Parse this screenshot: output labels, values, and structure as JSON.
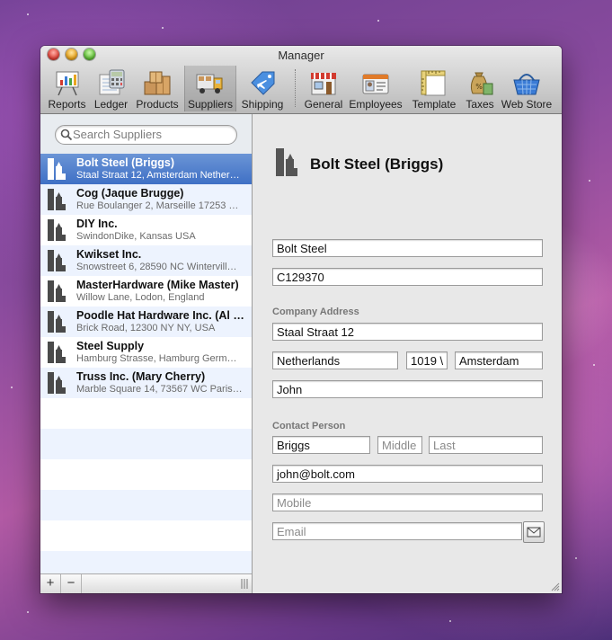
{
  "window": {
    "title": "Manager"
  },
  "toolbar": {
    "items": [
      {
        "label": "Reports",
        "icon": "chart-easel-icon"
      },
      {
        "label": "Ledger",
        "icon": "ledger-calculator-icon"
      },
      {
        "label": "Products",
        "icon": "boxes-icon"
      },
      {
        "label": "Suppliers",
        "icon": "truck-icon",
        "selected": true
      },
      {
        "label": "Shipping",
        "icon": "airplane-tag-icon"
      },
      {
        "label": "General",
        "icon": "store-icon"
      },
      {
        "label": "Employees",
        "icon": "id-card-icon"
      },
      {
        "label": "Template",
        "icon": "ruler-template-icon"
      },
      {
        "label": "Taxes",
        "icon": "money-bag-icon"
      },
      {
        "label": "Web Store",
        "icon": "shopping-basket-icon"
      }
    ]
  },
  "sidebar": {
    "search_placeholder": "Search Suppliers",
    "suppliers": [
      {
        "name": "Bolt Steel (Briggs)",
        "address": "Staal Straat 12, Amsterdam Nether…",
        "selected": true
      },
      {
        "name": "Cog (Jaque Brugge)",
        "address": "Rue Boulanger 2, Marseille 17253 …"
      },
      {
        "name": "DIY Inc.",
        "address": "SwindonDike, Kansas USA"
      },
      {
        "name": "Kwikset Inc.",
        "address": "Snowstreet 6, 28590 NC Wintervill…"
      },
      {
        "name": "MasterHardware (Mike Master)",
        "address": "Willow Lane, Lodon, England"
      },
      {
        "name": "Poodle Hat Hardware Inc. (Al …",
        "address": "Brick Road, 12300 NY NY, USA"
      },
      {
        "name": "Steel Supply",
        "address": "Hamburg Strasse, Hamburg Germ…"
      },
      {
        "name": "Truss Inc. (Mary Cherry)",
        "address": "Marble Square 14, 73567 WC Paris…"
      }
    ],
    "add_label": "+",
    "remove_label": "−"
  },
  "detail": {
    "title": "Bolt Steel (Briggs)",
    "company": "Bolt Steel",
    "code": "C129370",
    "address_label": "Company Address",
    "street": "Staal Straat 12",
    "country": "Netherlands",
    "zip": "1019 \\",
    "city": "Amsterdam",
    "address_extra": "John",
    "contact_label": "Contact Person",
    "first_name": "Briggs",
    "middle_placeholder": "Middle",
    "last_placeholder": "Last",
    "email_value": "john@bolt.com",
    "mobile_placeholder": "Mobile",
    "email_placeholder": "Email"
  }
}
